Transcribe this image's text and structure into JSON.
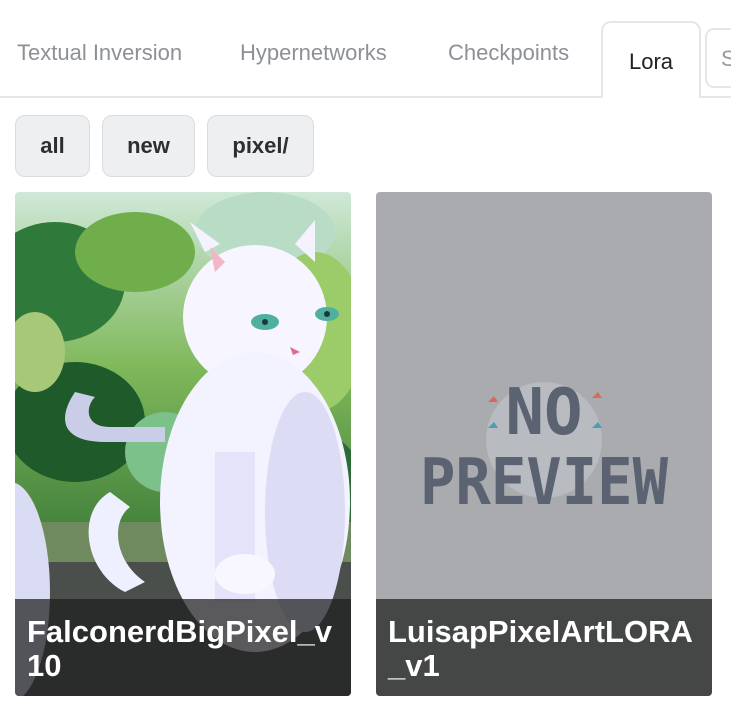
{
  "tabs": [
    {
      "label": "Textual Inversion"
    },
    {
      "label": "Hypernetworks"
    },
    {
      "label": "Checkpoints"
    },
    {
      "label": "Lora"
    },
    {
      "label": "S"
    }
  ],
  "filters": [
    {
      "label": "all"
    },
    {
      "label": "new"
    },
    {
      "label": "pixel/"
    }
  ],
  "cards": [
    {
      "name": "FalconerdBigPixel_v10"
    },
    {
      "name": "LuisapPixelArtLORA_v1",
      "placeholder_line1": "NO",
      "placeholder_line2": "PREVIEW"
    }
  ],
  "colors": {
    "active_tab_border": "#e6e6e9",
    "caption_overlay": "#1e1e1e",
    "placeholder_bg": "#a9abae"
  }
}
